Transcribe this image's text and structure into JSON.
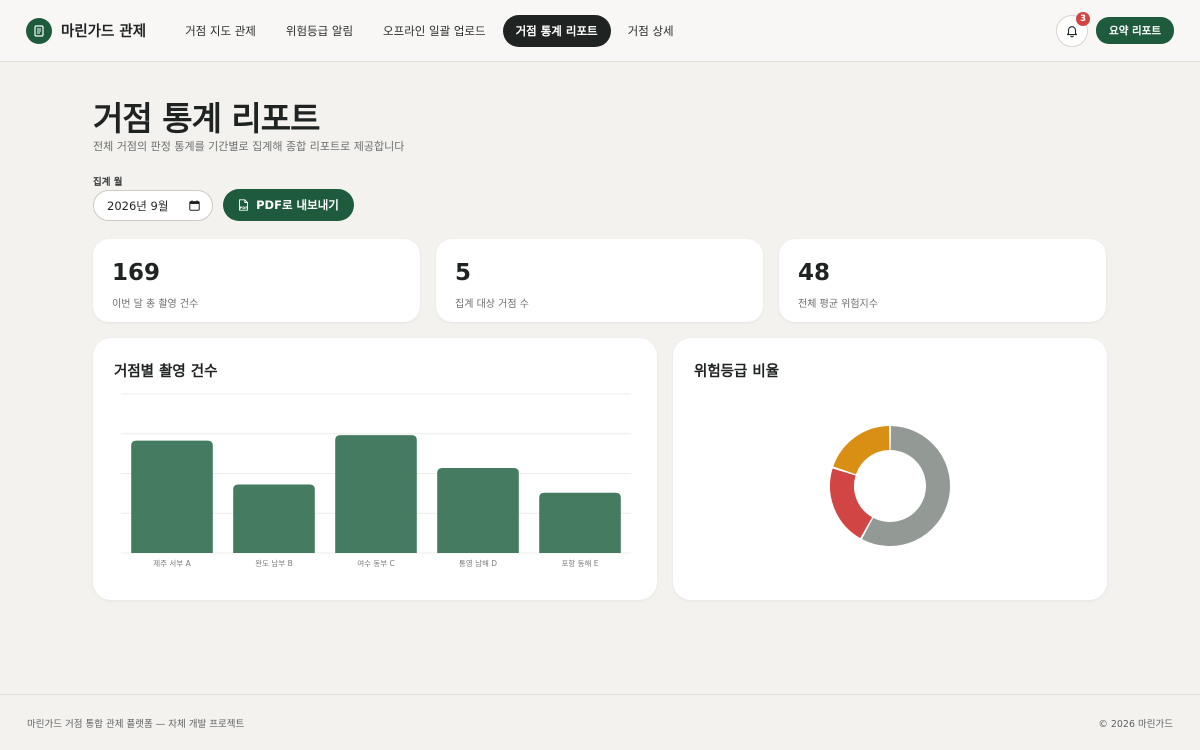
{
  "brand": {
    "name": "마린가드 관제"
  },
  "nav": [
    {
      "label": "거점 지도 관제",
      "active": false
    },
    {
      "label": "위험등급 알림",
      "active": false
    },
    {
      "label": "오프라인 일괄 업로드",
      "active": false
    },
    {
      "label": "거점 통계 리포트",
      "active": true
    },
    {
      "label": "거점 상세",
      "active": false
    }
  ],
  "header": {
    "notification_count": "3",
    "summary_label": "요약 리포트"
  },
  "page": {
    "title": "거점 통계 리포트",
    "subtitle": "전체 거점의 판정 통계를 기간별로 집계해 종합 리포트로 제공합니다"
  },
  "controls": {
    "month_label": "집계 월",
    "month_value": "2026년 9월",
    "pdf_label": "PDF로 내보내기",
    "pdf_icon_text": "PDF"
  },
  "stats": [
    {
      "value": "169",
      "label": "이번 달 총 촬영 건수"
    },
    {
      "value": "5",
      "label": "집계 대상 거점 수"
    },
    {
      "value": "48",
      "label": "전체 평균 위험지수"
    }
  ],
  "panels": {
    "bar_title": "거점별 촬영 건수",
    "donut_title": "위험등급 비율"
  },
  "colors": {
    "brand": "#1e5a3c",
    "bar": "#457b61",
    "donut_gray": "#939995",
    "donut_red": "#d24545",
    "donut_orange": "#d98f14"
  },
  "chart_data": [
    {
      "type": "bar",
      "categories": [
        "제주 서부 A",
        "완도 남부 B",
        "여수 동부 C",
        "통영 남해 D",
        "포항 동해 E"
      ],
      "values": [
        41,
        25,
        43,
        31,
        22
      ],
      "ylim": [
        0,
        58
      ],
      "grid": true
    },
    {
      "type": "pie",
      "slices": [
        {
          "value": 58,
          "color": "#939995"
        },
        {
          "value": 22,
          "color": "#d24545"
        },
        {
          "value": 20,
          "color": "#d98f14"
        }
      ]
    }
  ],
  "footer": {
    "left": "마린가드 거점 통합 관제 플랫폼 — 자체 개발 프로젝트",
    "right": "© 2026 마린가드"
  }
}
